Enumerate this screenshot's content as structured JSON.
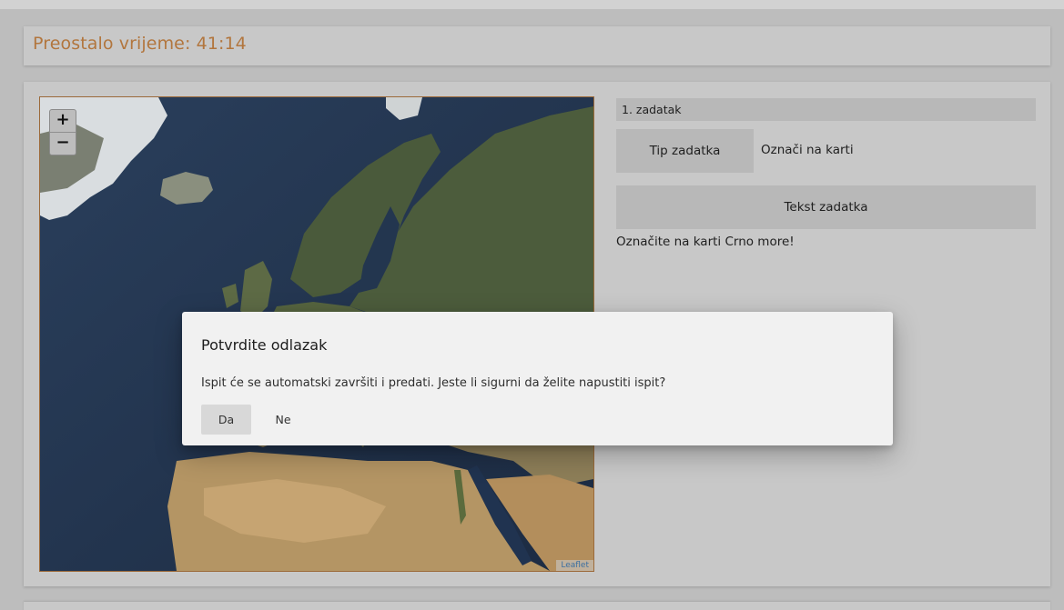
{
  "timer": {
    "label": "Preostalo vrijeme: 41:14",
    "color": "#b2763e"
  },
  "map": {
    "zoom_in_label": "+",
    "zoom_out_label": "−",
    "attribution": "Leaflet"
  },
  "task": {
    "number_label": "1. zadatak",
    "type_label": "Tip zadatka",
    "type_value": "Označi na karti",
    "text_label": "Tekst zadatka",
    "text_value": "Označite na karti Crno more!"
  },
  "dialog": {
    "title": "Potvrdite odlazak",
    "message": "Ispit će se automatski završiti i predati. Jeste li sigurni da želite napustiti ispit?",
    "confirm_label": "Da",
    "cancel_label": "Ne"
  }
}
